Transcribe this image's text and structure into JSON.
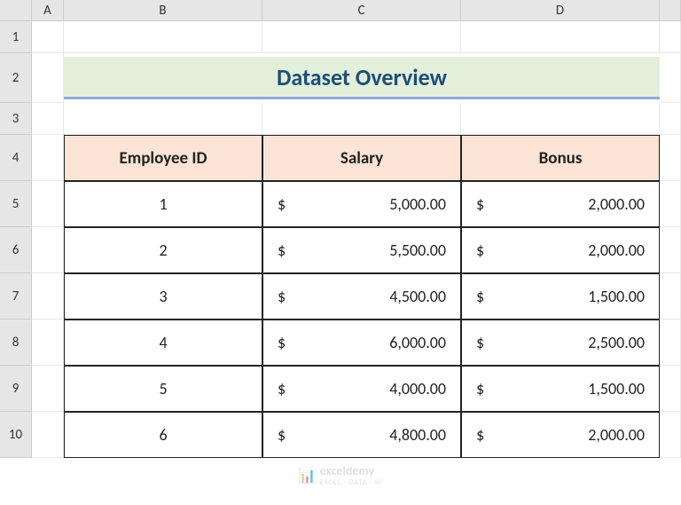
{
  "columns": [
    "A",
    "B",
    "C",
    "D"
  ],
  "rows": [
    "1",
    "2",
    "3",
    "4",
    "5",
    "6",
    "7",
    "8",
    "9",
    "10"
  ],
  "title": "Dataset Overview",
  "headers": {
    "employee_id": "Employee ID",
    "salary": "Salary",
    "bonus": "Bonus"
  },
  "data": [
    {
      "id": "1",
      "salary": "5,000.00",
      "bonus": "2,000.00"
    },
    {
      "id": "2",
      "salary": "5,500.00",
      "bonus": "2,000.00"
    },
    {
      "id": "3",
      "salary": "4,500.00",
      "bonus": "1,500.00"
    },
    {
      "id": "4",
      "salary": "6,000.00",
      "bonus": "2,500.00"
    },
    {
      "id": "5",
      "salary": "4,000.00",
      "bonus": "1,500.00"
    },
    {
      "id": "6",
      "salary": "4,800.00",
      "bonus": "2,000.00"
    }
  ],
  "currency_symbol": "$",
  "watermark": {
    "text": "exceldemy",
    "sub": "EXCEL · DATA · BI"
  }
}
